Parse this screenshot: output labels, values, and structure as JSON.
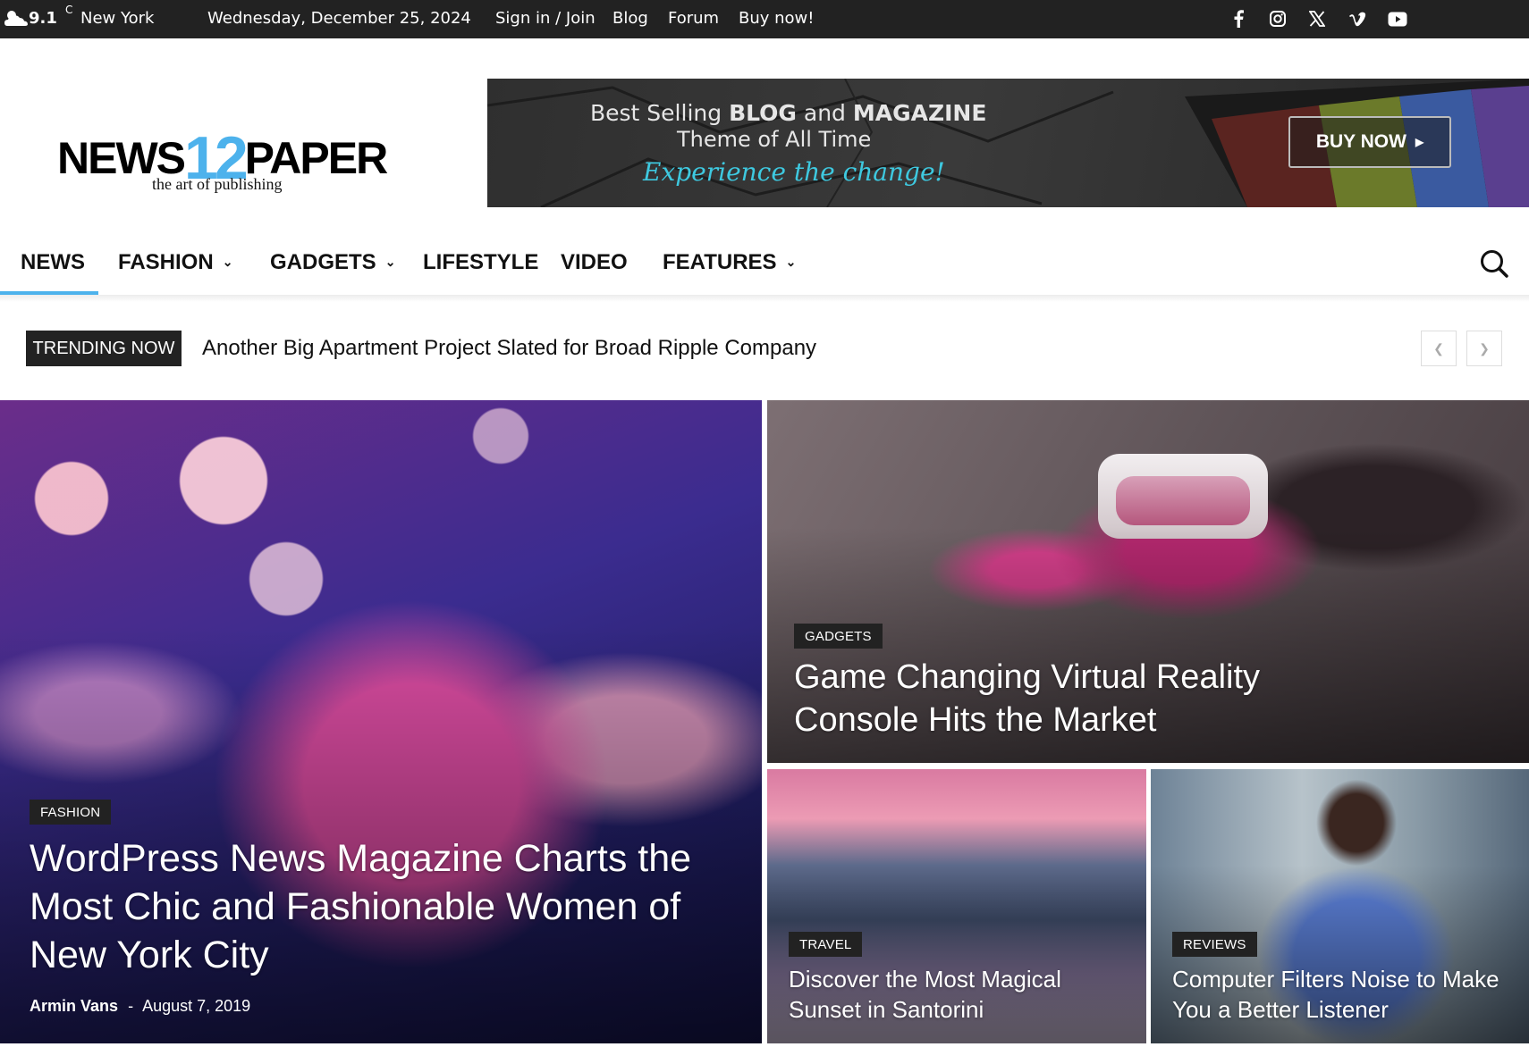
{
  "topbar": {
    "temp": "9.1",
    "unit": "C",
    "city": "New York",
    "date": "Wednesday, December 25, 2024",
    "links": [
      "Sign in / Join",
      "Blog",
      "Forum",
      "Buy now!"
    ],
    "socials": [
      "facebook-icon",
      "instagram-icon",
      "x-icon",
      "vimeo-icon",
      "youtube-icon"
    ]
  },
  "logo": {
    "word1": "NEWS",
    "num": "12",
    "word2": "PAPER",
    "tagline": "the art of publishing"
  },
  "banner": {
    "line1_pre": "Best Selling ",
    "line1_b1": "BLOG",
    "line1_mid": " and ",
    "line1_b2": "MAGAZINE",
    "line2": "Theme of All Time",
    "line3": "Experience the change!",
    "button": "BUY NOW"
  },
  "nav": {
    "items": [
      "NEWS",
      "FASHION",
      "GADGETS",
      "LIFESTYLE",
      "VIDEO",
      "FEATURES"
    ],
    "active": "NEWS",
    "accent": "#4db2ec"
  },
  "trending": {
    "label": "TRENDING NOW",
    "headline": "Another Big Apartment Project Slated for Broad Ripple Company"
  },
  "tiles": [
    {
      "category": "FASHION",
      "title": "WordPress News Magazine Charts the Most Chic and Fashionable Women of New York City",
      "author": "Armin Vans",
      "separator": "-",
      "date": "August 7, 2019"
    },
    {
      "category": "GADGETS",
      "title": "Game Changing Virtual Reality Console Hits the Market"
    },
    {
      "category": "TRAVEL",
      "title": "Discover the Most Magical Sunset in Santorini"
    },
    {
      "category": "REVIEWS",
      "title": "Computer Filters Noise to Make You a Better Listener"
    }
  ]
}
